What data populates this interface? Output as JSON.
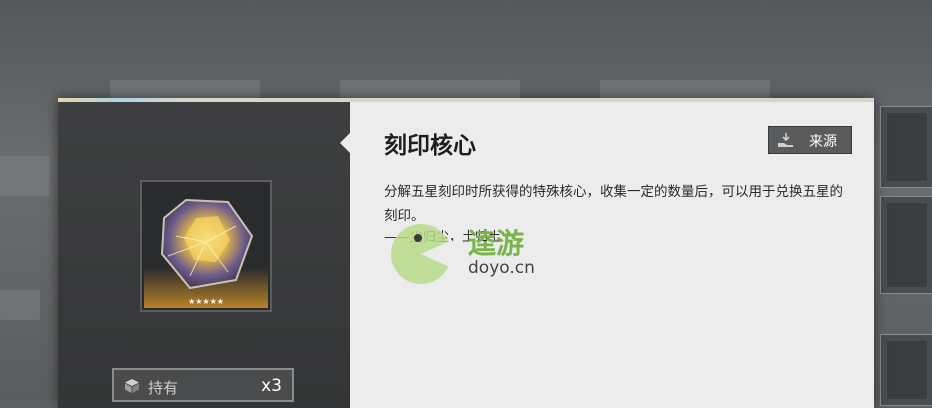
{
  "modal": {
    "title": "刻印核心",
    "source_label": "来源",
    "description": "分解五星刻印时所获得的特殊核心，收集一定的数量后，可以用于兑换五星的刻印。",
    "subtext": "——尘归尘，土归土",
    "item": {
      "icon": "engraving-core-gem",
      "rarity": 5,
      "stars": "★★★★★"
    },
    "hold": {
      "label": "持有",
      "count": "x3",
      "icon": "cube-icon"
    }
  },
  "watermark": {
    "brand": "逵游",
    "domain": "doyo.cn"
  },
  "colors": {
    "panel_light": "#ececec",
    "panel_dark": "#3e3f40",
    "accent_glow": "#e6a028",
    "watermark_green": "#7ab34a"
  }
}
